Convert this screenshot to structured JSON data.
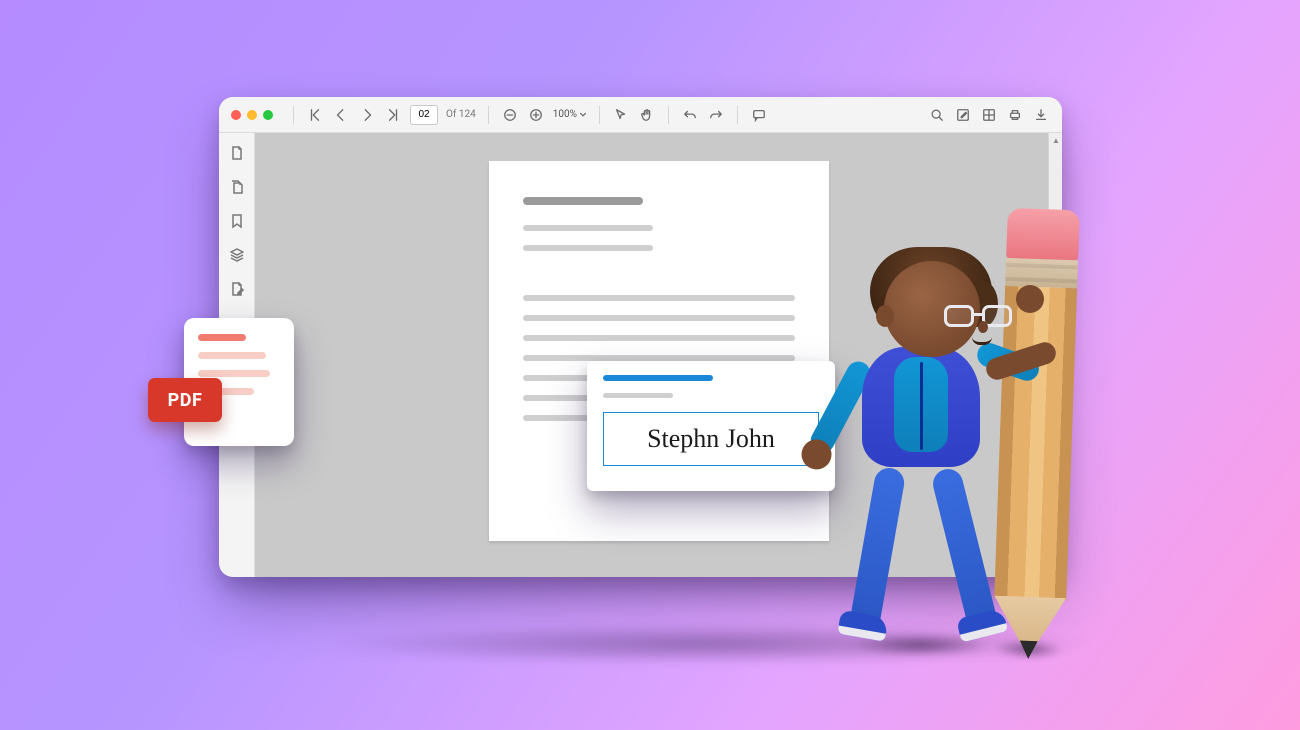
{
  "toolbar": {
    "page_current": "02",
    "page_of_prefix": "Of",
    "page_total": "124",
    "zoom_level": "100%"
  },
  "signature": {
    "value": "Stephn John"
  },
  "pdf_badge": {
    "label": "PDF"
  },
  "icons": {
    "window_close": "close",
    "window_min": "minimize",
    "window_max": "maximize",
    "first_page": "first-page",
    "prev_page": "prev-page",
    "next_page": "next-page",
    "last_page": "last-page",
    "zoom_out": "zoom-out",
    "zoom_in": "zoom-in",
    "zoom_dropdown": "chevron-down",
    "selection": "cursor",
    "pan": "hand",
    "undo": "undo",
    "redo": "redo",
    "annotate": "comment",
    "search": "search",
    "edit": "edit-annotation",
    "thumbnails": "grid",
    "print": "print",
    "download": "download",
    "rail_page": "page",
    "rail_pages": "pages-stack",
    "rail_bookmark": "bookmark",
    "rail_layers": "layers",
    "rail_sign": "sign-document"
  }
}
